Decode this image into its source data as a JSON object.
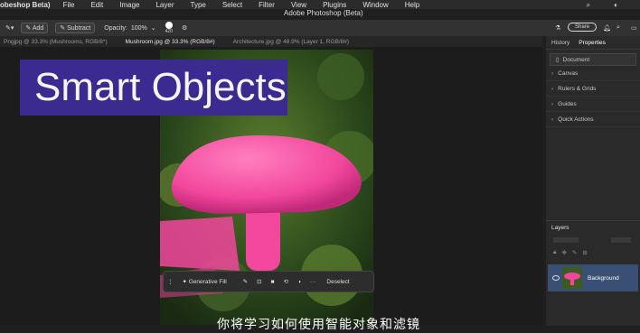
{
  "menubar": {
    "app": "obeshop Beta)",
    "items": [
      "File",
      "Edit",
      "Image",
      "Layer",
      "Type",
      "Select",
      "Filter",
      "View",
      "Plugins",
      "Window",
      "Help"
    ]
  },
  "window": {
    "title": "Adobe Photoshop (Beta)",
    "share_label": "Share"
  },
  "toolbar": {
    "add_label": "Add",
    "subtract_label": "Subtract",
    "opacity_label": "Opacity:",
    "opacity_value": "100%",
    "size_value": "420"
  },
  "tabs": [
    "Pngjpg @ 33.3% (Mushrooms, RGB/8*)",
    "Mushroom.jpg @ 33.3% (RGB/8#)",
    "Architecture.jpg @ 48.9% (Layer 1, RGB/8#)"
  ],
  "overlay": {
    "title": "Smart Objects"
  },
  "context_bar": {
    "generative_fill": "Generative Fill",
    "deselect": "Deselect"
  },
  "subtitle": "你将学习如何使用智能对象和滤镜",
  "right_panel": {
    "tabs": [
      "History",
      "Properties"
    ],
    "document_label": "Document",
    "sections": [
      "Canvas",
      "Rulers & Grids",
      "Guides",
      "Quick Actions"
    ]
  },
  "layers_panel": {
    "title": "Layers",
    "layer_name": "Background"
  },
  "colors": {
    "accent_purple": "#3b2a8f",
    "layer_selected": "#3a4f74",
    "mushroom_pink": "#f2479c"
  }
}
